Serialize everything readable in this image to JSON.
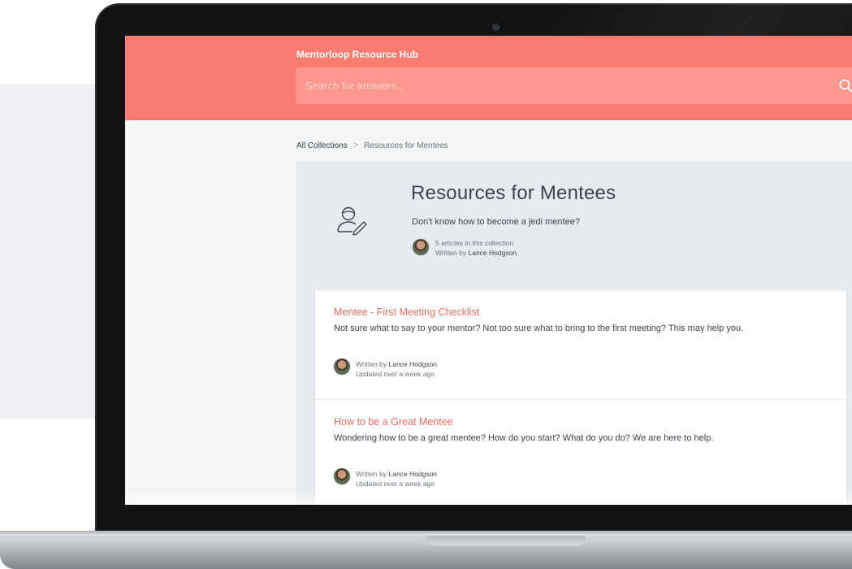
{
  "header": {
    "hub_title": "Mentorloop Resource Hub",
    "search_placeholder": "Search for answers..."
  },
  "breadcrumb": {
    "home": "All Collections",
    "separator": ">",
    "current": "Resources for Mentees"
  },
  "collection": {
    "title": "Resources for Mentees",
    "description": "Don't know how to become a jedi mentee?",
    "article_count": "5 articles in this collection",
    "written_by_prefix": "Written by",
    "author": "Lance Hodgson",
    "icon": "mentee-edit-icon"
  },
  "articles": [
    {
      "title": "Mentee - First Meeting Checklist",
      "summary": "Not sure what to say to your mentor? Not too sure what to bring to the first meeting? This may help you.",
      "written_by_prefix": "Written by",
      "author": "Lance Hodgson",
      "updated": "Updated over a week ago"
    },
    {
      "title": "How to be a Great Mentee",
      "summary": "Wondering how to be a great mentee? How do you start? What do you do? We are here to help.",
      "written_by_prefix": "Written by",
      "author": "Lance Hodgson",
      "updated": "Updated over a week ago"
    }
  ],
  "colors": {
    "header": "#fc7b71",
    "search_bar": "#fd978f",
    "link": "#f26d60",
    "hero_bg": "#e7eaee",
    "text": "#3b4350"
  }
}
